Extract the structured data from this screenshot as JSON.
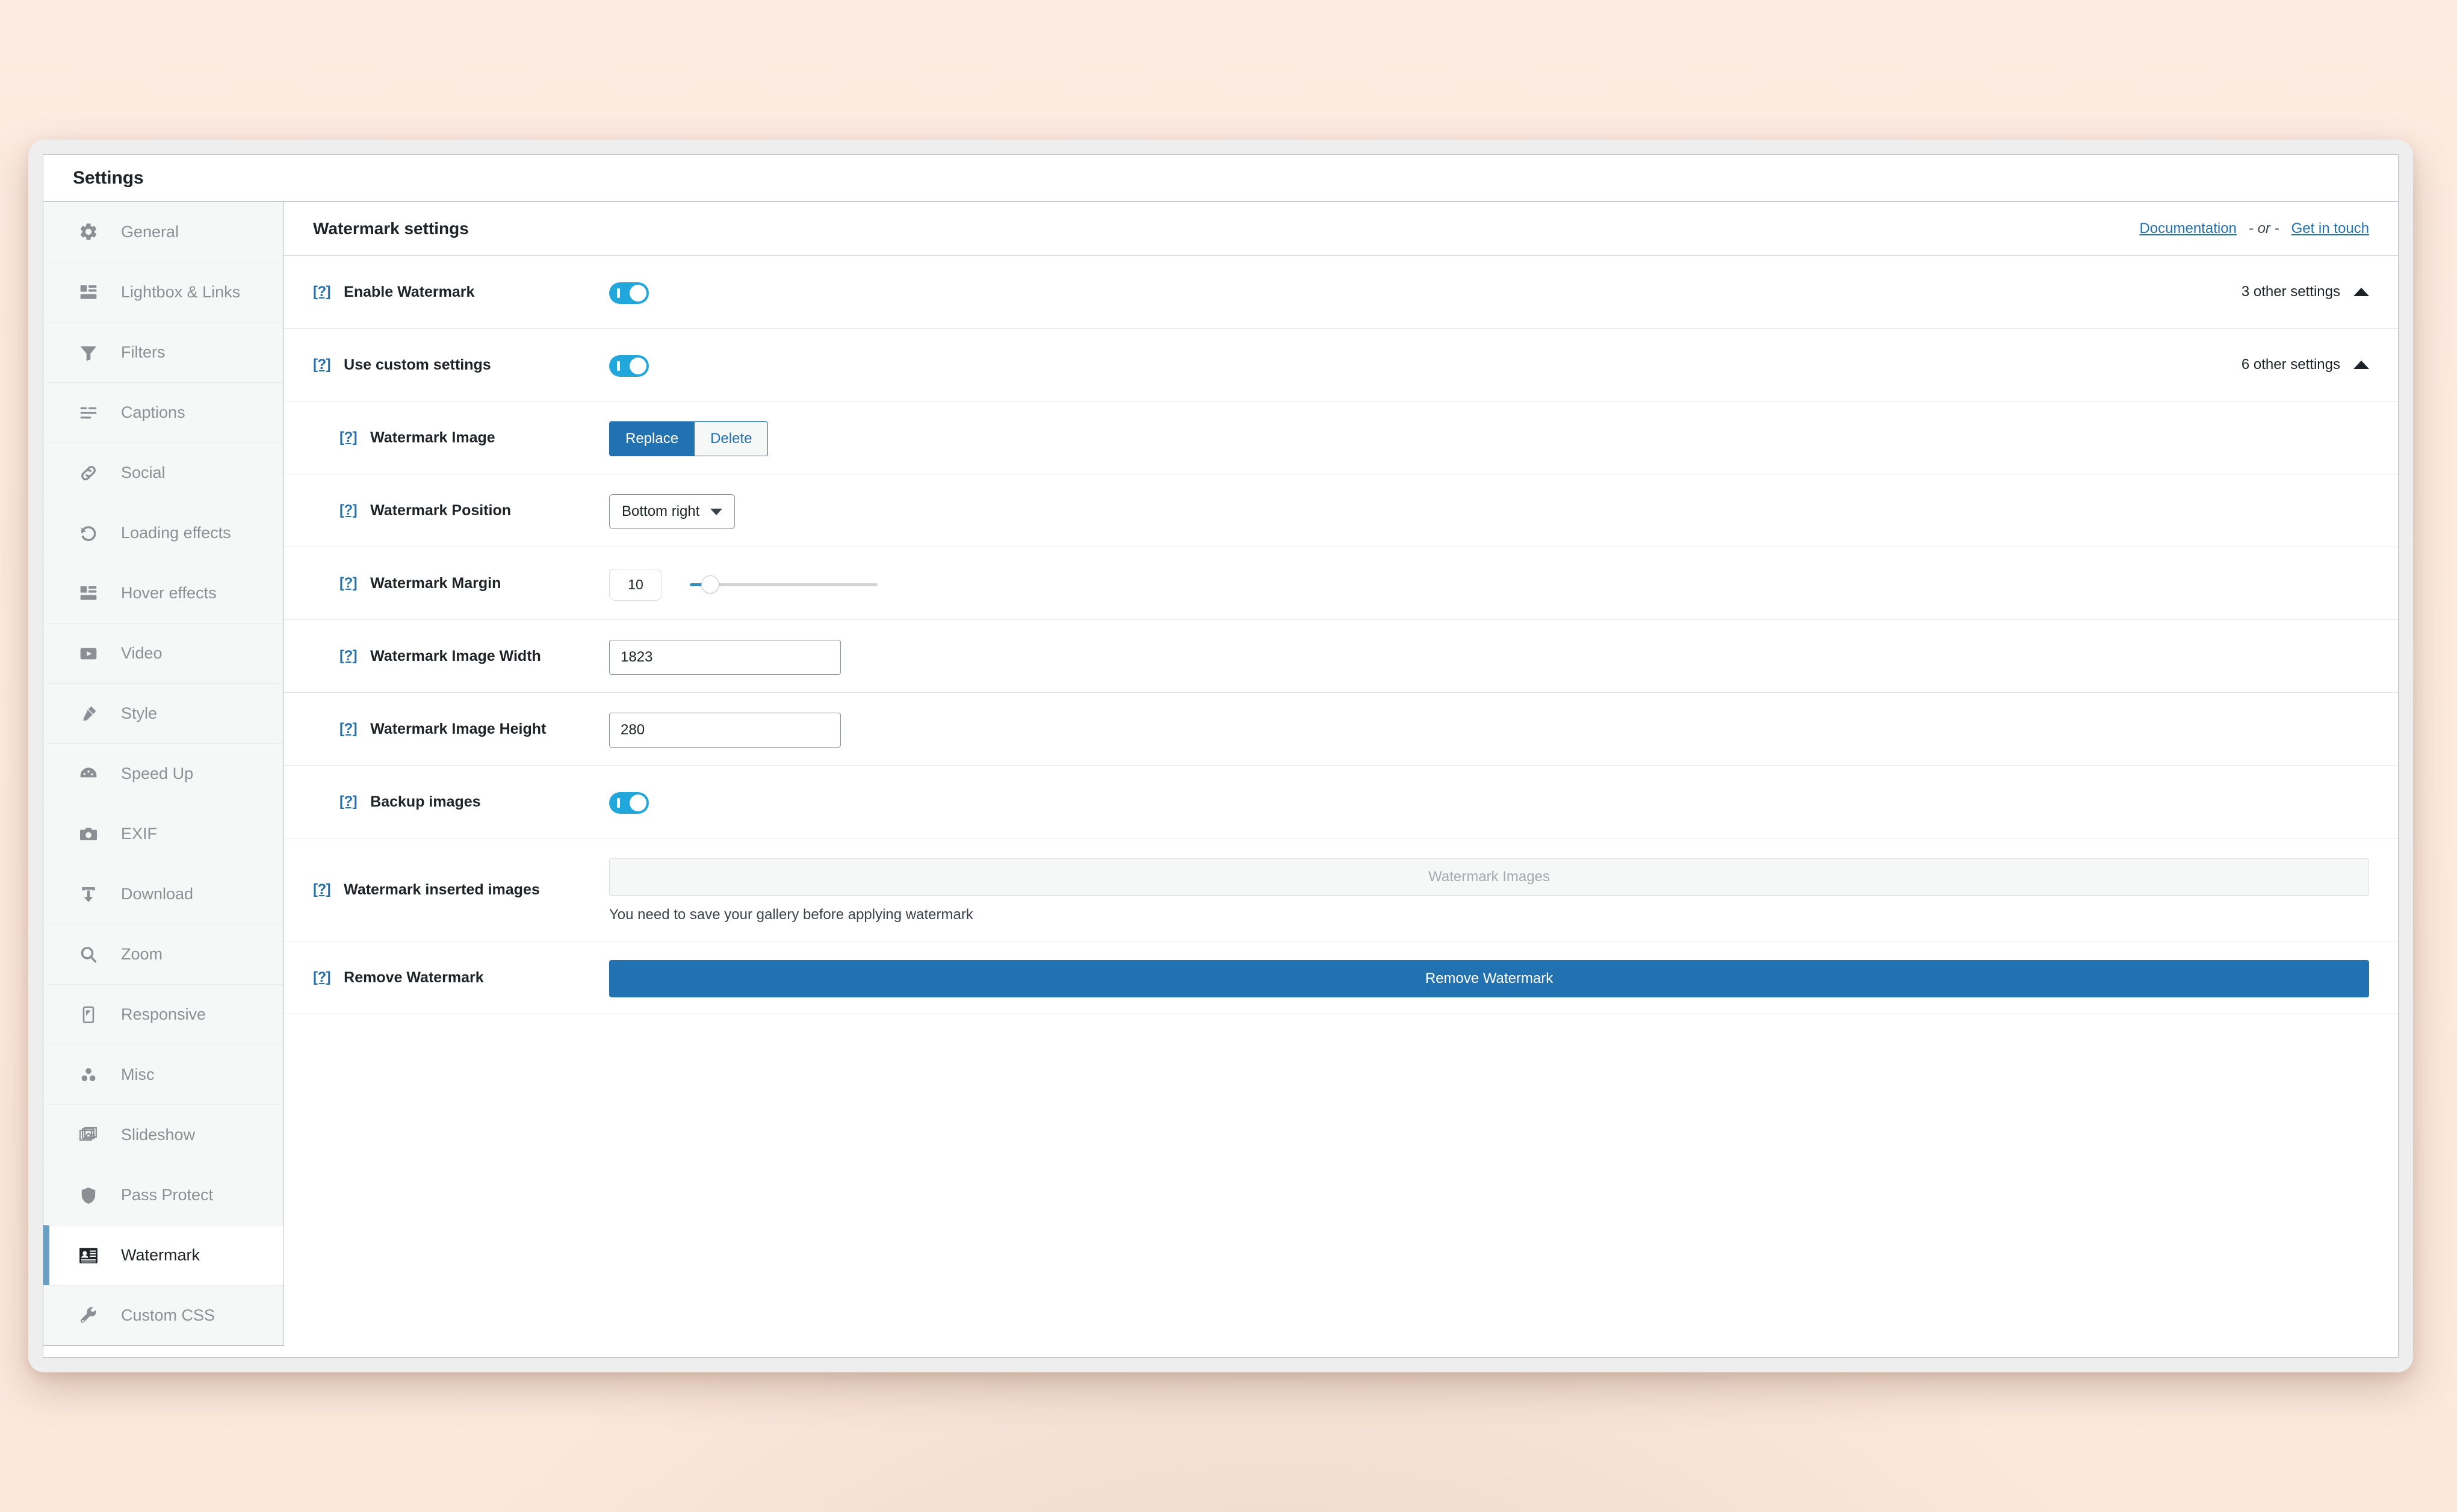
{
  "window": {
    "title": "Settings"
  },
  "sidebar": {
    "items": [
      {
        "label": "General",
        "icon": "gear-icon",
        "active": false
      },
      {
        "label": "Lightbox & Links",
        "icon": "layout-icon",
        "active": false
      },
      {
        "label": "Filters",
        "icon": "funnel-icon",
        "active": false
      },
      {
        "label": "Captions",
        "icon": "text-lines-icon",
        "active": false
      },
      {
        "label": "Social",
        "icon": "link-icon",
        "active": false
      },
      {
        "label": "Loading effects",
        "icon": "refresh-icon",
        "active": false
      },
      {
        "label": "Hover effects",
        "icon": "layout-icon",
        "active": false
      },
      {
        "label": "Video",
        "icon": "video-icon",
        "active": false
      },
      {
        "label": "Style",
        "icon": "paintbrush-icon",
        "active": false
      },
      {
        "label": "Speed Up",
        "icon": "gauge-icon",
        "active": false
      },
      {
        "label": "EXIF",
        "icon": "camera-icon",
        "active": false
      },
      {
        "label": "Download",
        "icon": "download-icon",
        "active": false
      },
      {
        "label": "Zoom",
        "icon": "magnifier-icon",
        "active": false
      },
      {
        "label": "Responsive",
        "icon": "mobile-icon",
        "active": false
      },
      {
        "label": "Misc",
        "icon": "dots-cluster-icon",
        "active": false
      },
      {
        "label": "Slideshow",
        "icon": "images-stack-icon",
        "active": false
      },
      {
        "label": "Pass Protect",
        "icon": "shield-icon",
        "active": false
      },
      {
        "label": "Watermark",
        "icon": "watermark-icon",
        "active": true
      },
      {
        "label": "Custom CSS",
        "icon": "wrench-icon",
        "active": false
      }
    ]
  },
  "content": {
    "header": {
      "title": "Watermark settings",
      "documentation_label": "Documentation",
      "separator": "- or -",
      "contact_label": "Get in touch"
    },
    "help_icon_label": "[?]",
    "rows": {
      "enable_watermark": {
        "label": "Enable Watermark",
        "toggle_on": true,
        "aside": "3 other settings"
      },
      "use_custom_settings": {
        "label": "Use custom settings",
        "toggle_on": true,
        "aside": "6 other settings"
      },
      "watermark_image": {
        "label": "Watermark Image",
        "replace_label": "Replace",
        "delete_label": "Delete"
      },
      "watermark_position": {
        "label": "Watermark Position",
        "value": "Bottom right"
      },
      "watermark_margin": {
        "label": "Watermark Margin",
        "value": "10"
      },
      "watermark_image_width": {
        "label": "Watermark Image Width",
        "value": "1823"
      },
      "watermark_image_height": {
        "label": "Watermark Image Height",
        "value": "280"
      },
      "backup_images": {
        "label": "Backup images",
        "toggle_on": true
      },
      "watermark_inserted_images": {
        "label": "Watermark inserted images",
        "button_label": "Watermark Images",
        "note": "You need to save your gallery before applying watermark"
      },
      "remove_watermark": {
        "label": "Remove Watermark",
        "button_label": "Remove Watermark"
      }
    }
  },
  "colors": {
    "accent_blue": "#2271b1",
    "toggle_blue": "#22a7dd",
    "active_border": "#6a9fc4",
    "page_background": "#fdeade"
  }
}
